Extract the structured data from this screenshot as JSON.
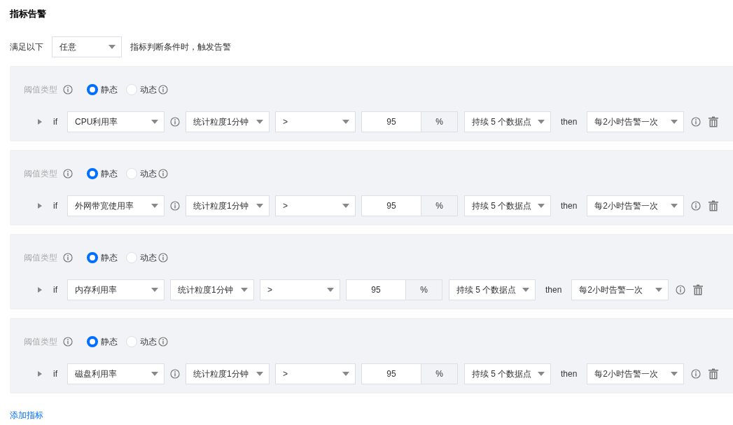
{
  "title": "指标告警",
  "condition": {
    "prefix": "满足以下",
    "select": "任意",
    "suffix": "指标判断条件时，触发告警"
  },
  "rules": [
    {
      "threshold_label": "阈值类型",
      "options": [
        {
          "label": "静态",
          "selected": true,
          "info": false
        },
        {
          "label": "动态",
          "selected": false,
          "info": true
        }
      ],
      "if": "if",
      "metric": "CPU利用率",
      "metric_info": true,
      "period": "统计粒度1分钟",
      "operator": ">",
      "value": "95",
      "unit": "%",
      "duration": "持续 5 个数据点",
      "then": "then",
      "frequency": "每2小时告警一次"
    },
    {
      "threshold_label": "阈值类型",
      "options": [
        {
          "label": "静态",
          "selected": true,
          "info": false
        },
        {
          "label": "动态",
          "selected": false,
          "info": true
        }
      ],
      "if": "if",
      "metric": "外网带宽使用率",
      "metric_info": true,
      "period": "统计粒度1分钟",
      "operator": ">",
      "value": "95",
      "unit": "%",
      "duration": "持续 5 个数据点",
      "then": "then",
      "frequency": "每2小时告警一次"
    },
    {
      "threshold_label": "阈值类型",
      "options": [
        {
          "label": "静态",
          "selected": true,
          "info": false
        },
        {
          "label": "动态",
          "selected": false,
          "info": true
        }
      ],
      "if": "if",
      "metric": "内存利用率",
      "metric_info": false,
      "period": "统计粒度1分钟",
      "operator": ">",
      "value": "95",
      "unit": "%",
      "duration": "持续 5 个数据点",
      "then": "then",
      "frequency": "每2小时告警一次"
    },
    {
      "threshold_label": "阈值类型",
      "options": [
        {
          "label": "静态",
          "selected": true,
          "info": false
        },
        {
          "label": "动态",
          "selected": false,
          "info": true
        }
      ],
      "if": "if",
      "metric": "磁盘利用率",
      "metric_info": true,
      "period": "统计粒度1分钟",
      "operator": ">",
      "value": "95",
      "unit": "%",
      "duration": "持续 5 个数据点",
      "then": "then",
      "frequency": "每2小时告警一次"
    }
  ],
  "add_link": "添加指标"
}
